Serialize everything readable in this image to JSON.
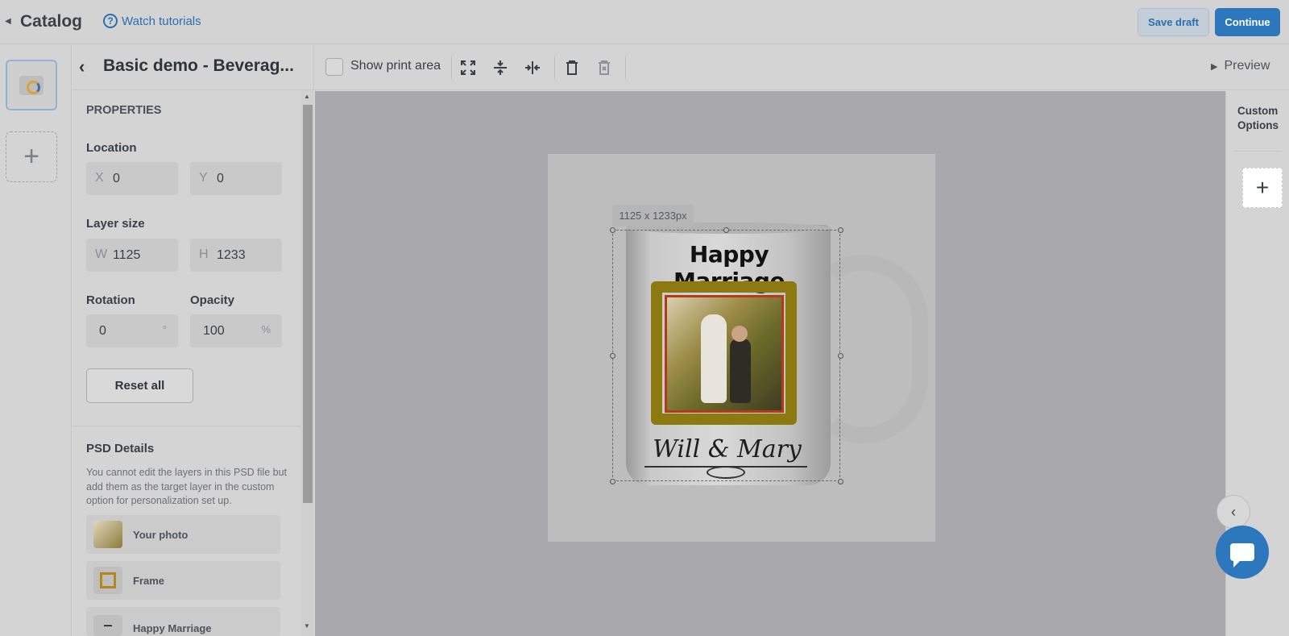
{
  "header": {
    "back_label": "Catalog",
    "tutorials_label": "Watch tutorials",
    "save_draft_label": "Save draft",
    "continue_label": "Continue"
  },
  "panel": {
    "title": "Basic demo - Beverag...",
    "properties_heading": "PROPERTIES",
    "location": {
      "label": "Location",
      "x_prefix": "X",
      "x_value": "0",
      "y_prefix": "Y",
      "y_value": "0"
    },
    "layer_size": {
      "label": "Layer size",
      "w_prefix": "W",
      "w_value": "1125",
      "h_prefix": "H",
      "h_value": "1233"
    },
    "rotation": {
      "label": "Rotation",
      "value": "0",
      "unit": "°"
    },
    "opacity": {
      "label": "Opacity",
      "value": "100",
      "unit": "%"
    },
    "reset_label": "Reset all",
    "psd": {
      "heading": "PSD Details",
      "description": "You cannot edit the layers in this PSD file but add them as the target layer in the custom option for personalization set up.",
      "layers": [
        {
          "name": "Your photo"
        },
        {
          "name": "Frame"
        },
        {
          "name": "Happy Marriage"
        }
      ]
    }
  },
  "toolbar": {
    "show_print_area_label": "Show print area",
    "show_print_area_checked": false,
    "preview_label": "Preview"
  },
  "canvas": {
    "size_tag": "1125 x 1233px",
    "mug_headline": "Happy Marriage",
    "mug_names": "Will & Mary"
  },
  "right": {
    "custom_options_line1": "Custom",
    "custom_options_line2": "Options"
  },
  "colors": {
    "accent": "#2d78bd",
    "overlay_dim": "#a8a8ad"
  }
}
